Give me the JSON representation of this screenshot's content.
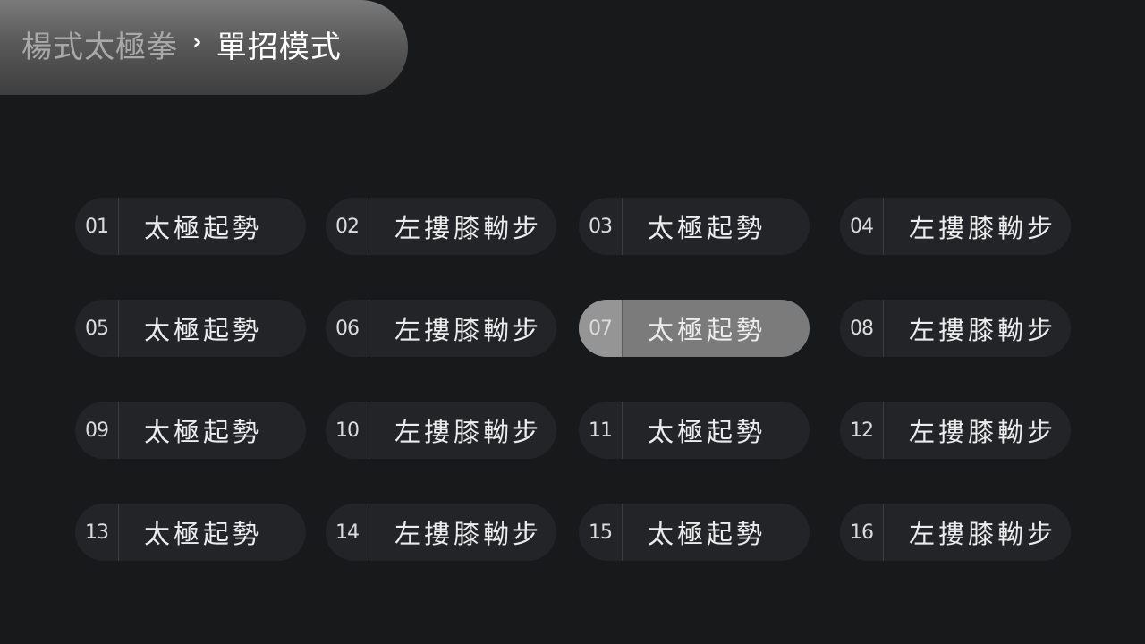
{
  "breadcrumb": {
    "parent": "楊式太極拳",
    "separator": "›",
    "current": "單招模式"
  },
  "selected_index": 6,
  "moves": [
    {
      "num": "01",
      "name": "太極起勢"
    },
    {
      "num": "02",
      "name": "左摟膝軪步"
    },
    {
      "num": "03",
      "name": "太極起勢"
    },
    {
      "num": "04",
      "name": "左摟膝軪步"
    },
    {
      "num": "05",
      "name": "太極起勢"
    },
    {
      "num": "06",
      "name": "左摟膝軪步"
    },
    {
      "num": "07",
      "name": "太極起勢"
    },
    {
      "num": "08",
      "name": "左摟膝軪步"
    },
    {
      "num": "09",
      "name": "太極起勢"
    },
    {
      "num": "10",
      "name": "左摟膝軪步"
    },
    {
      "num": "11",
      "name": "太極起勢"
    },
    {
      "num": "12",
      "name": "左摟膝軪步"
    },
    {
      "num": "13",
      "name": "太極起勢"
    },
    {
      "num": "14",
      "name": "左摟膝軪步"
    },
    {
      "num": "15",
      "name": "太極起勢"
    },
    {
      "num": "16",
      "name": "左摟膝軪步"
    }
  ]
}
